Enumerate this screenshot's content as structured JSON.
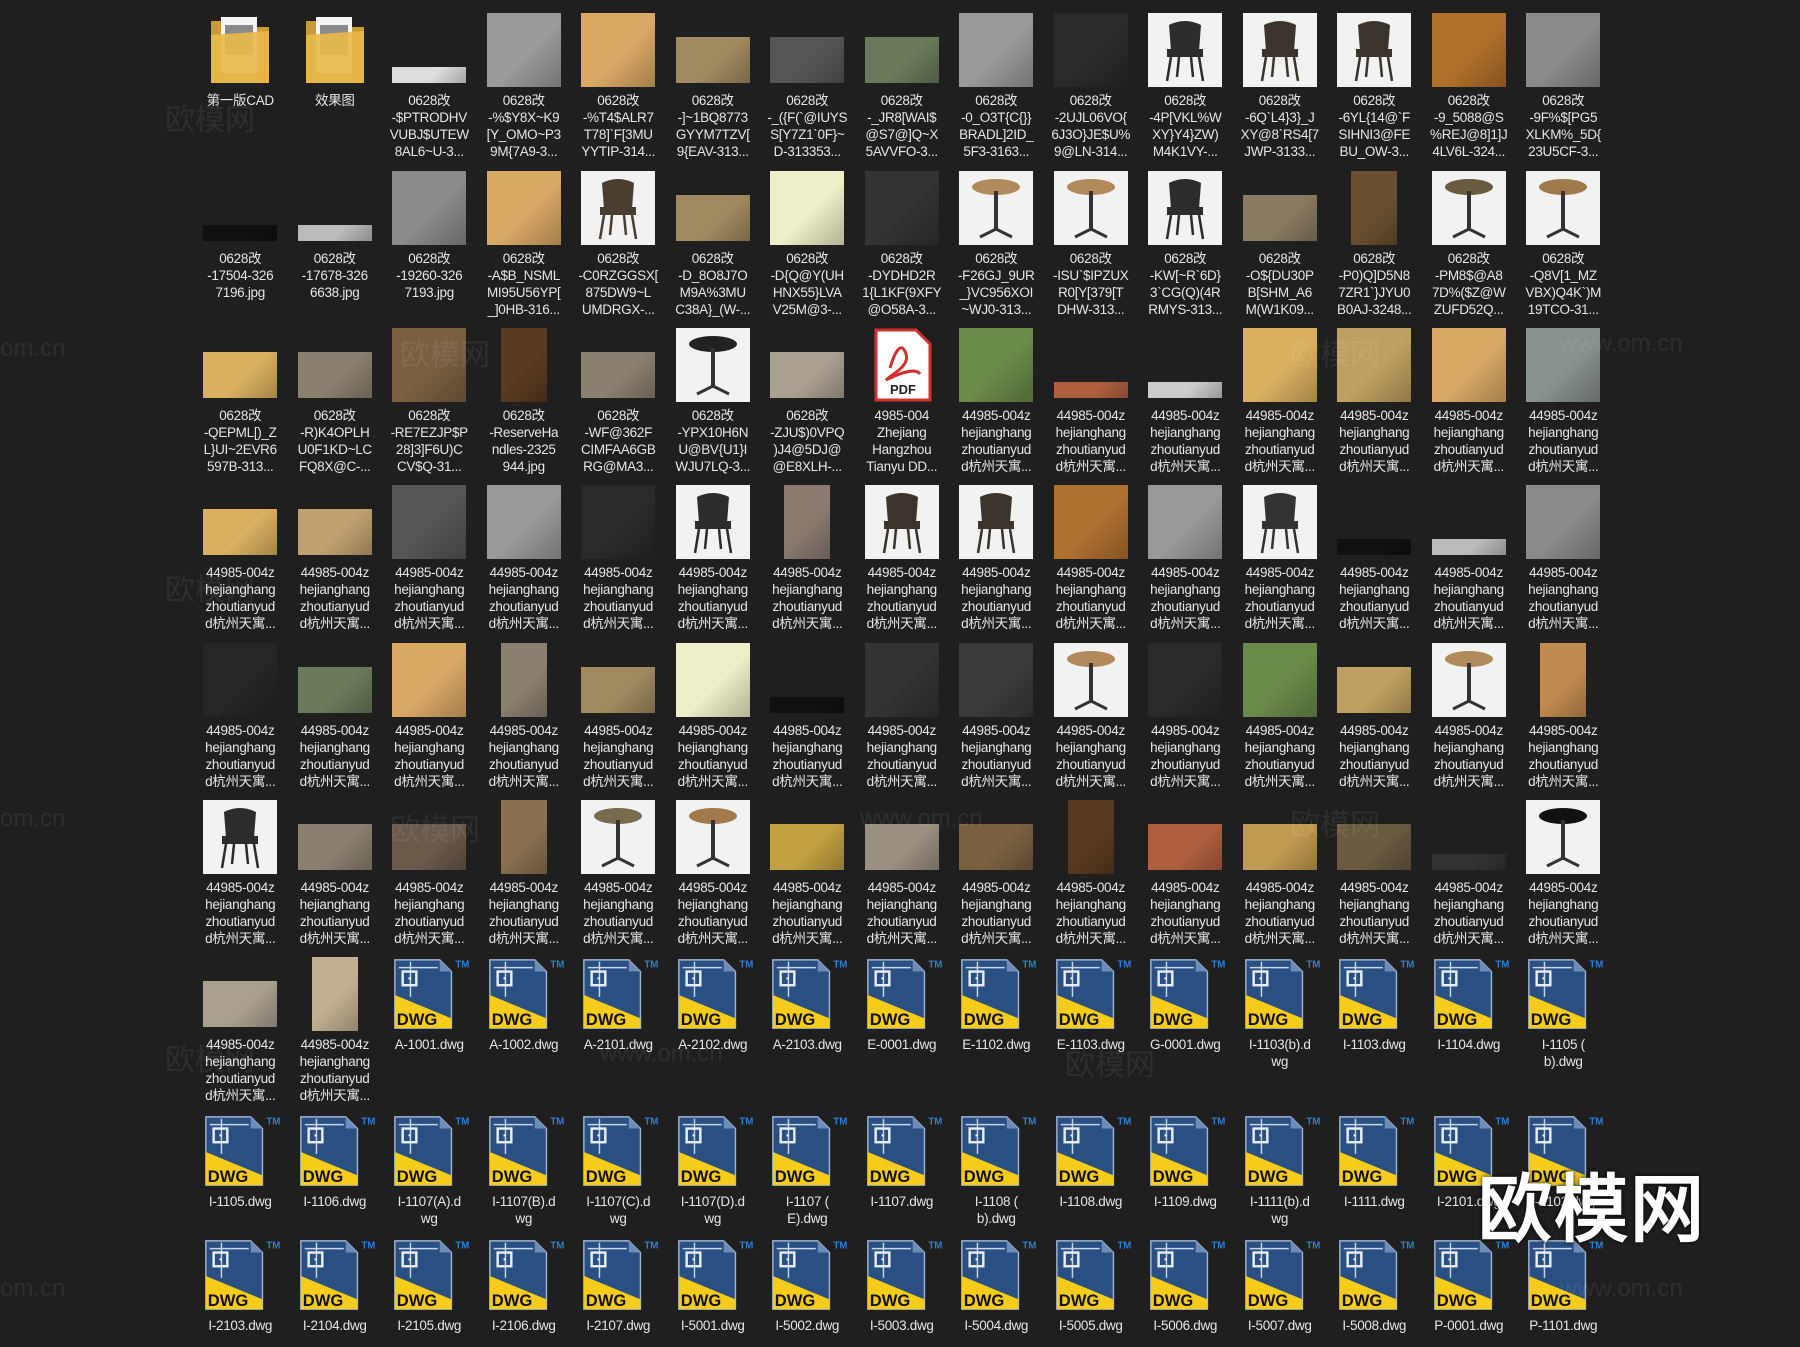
{
  "rows": [
    [
      {
        "label": "第一版CAD",
        "kind": "folder",
        "color": "#e8b84a"
      },
      {
        "label": "效果图",
        "kind": "folder",
        "color": "#e8b84a"
      },
      {
        "label": "0628改\n-$PTRODHV\nVUBJ$UTEW\n8AL6~U-3...",
        "kind": "strip",
        "color": "#dddddd"
      },
      {
        "label": "0628改\n-%$Y8X~K9\n[Y_OMO~P3\n9M{7A9-3...",
        "kind": "sq",
        "color": "#9a9a9a"
      },
      {
        "label": "0628改\n-%T4$ALR7\nT78]`F[3MU\nYYTIP-314...",
        "kind": "sq",
        "color": "#d9a865"
      },
      {
        "label": "0628改\n-]~1BQ8773\nGYYM7TZV[\n9{EAV-313...",
        "kind": "wide",
        "color": "#a08a60"
      },
      {
        "label": "0628改\n-_({F(`@IUYS\nS[Y7Z1`0F}~\nD-313353...",
        "kind": "wide",
        "color": "#555555"
      },
      {
        "label": "0628改\n-_JR8[WAI$\n@S7@]Q~X\n5AVVFO-3...",
        "kind": "wide",
        "color": "#6a7a5a"
      },
      {
        "label": "0628改\n-0_O3T{C{}}\nBRADL]2ID_\n5F3-3163...",
        "kind": "sq",
        "color": "#999999"
      },
      {
        "label": "0628改\n-2UJL06VO{\n6J3O}JE$U%\n9@LN-314...",
        "kind": "sq",
        "color": "#2a2a2a"
      },
      {
        "label": "0628改\n-4P[VKL%W\nXY}Y4}ZW)\nM4K1VY-...",
        "kind": "chair",
        "color": "#2c2c2c"
      },
      {
        "label": "0628改\n-6Q`L4}3}_J\nXY@8`RS4[7\nJWP-3133...",
        "kind": "chair",
        "color": "#3a342c"
      },
      {
        "label": "0628改\n-6YL{14@`F\nSIHNI3@FE\nBU_OW-3...",
        "kind": "chair",
        "color": "#3a342c"
      },
      {
        "label": "0628改\n-9_5088@S\n%REJ@8]1]J\n4LV6L-324...",
        "kind": "sq",
        "color": "#b0702a"
      },
      {
        "label": "0628改\n-9F%$[PG5\nXLKM%_5D{\n23U5CF-3...",
        "kind": "sq",
        "color": "#8a8a8a"
      }
    ],
    [
      {
        "label": "0628改\n-17504-326\n7196.jpg",
        "kind": "strip",
        "color": "#111111"
      },
      {
        "label": "0628改\n-17678-326\n6638.jpg",
        "kind": "strip",
        "color": "#bbbbbb"
      },
      {
        "label": "0628改\n-19260-326\n7193.jpg",
        "kind": "sq",
        "color": "#8a8a8a"
      },
      {
        "label": "0628改\n-A$B_NSML\nMI95U56YP[\n_]0HB-316...",
        "kind": "sq",
        "color": "#d9a865"
      },
      {
        "label": "0628改\n-C0RZGGSX[\n875DW9~L\nUMDRGX-...",
        "kind": "chair",
        "color": "#4a3e30"
      },
      {
        "label": "0628改\n-D_8O8J7O\nM9A%3MU\nC38A}_(W-...",
        "kind": "wide",
        "color": "#a08a60"
      },
      {
        "label": "0628改\n-D{Q@Y(UH\nHNX55}LVA\nV25M@3-...",
        "kind": "sq",
        "color": "#eeeec8"
      },
      {
        "label": "0628改\n-DYDHD2R\n1{L1KF(9XFY\n@O58A-3...",
        "kind": "sq",
        "color": "#333333"
      },
      {
        "label": "0628改\n-F26GJ_9UR\n_}VC956XOI\n~WJ0-313...",
        "kind": "table",
        "color": "#b08a5a"
      },
      {
        "label": "0628改\n-ISU`$IPZUX\nR0[Y[379[T\nDHW-313...",
        "kind": "table",
        "color": "#b08a5a"
      },
      {
        "label": "0628改\n-KW[~R`6D}\n3`CG(Q)(4R\nRMYS-313...",
        "kind": "chair",
        "color": "#2c2c2c"
      },
      {
        "label": "0628改\n-O${DU30P\nB[SHM_A6\nM(W1K09...",
        "kind": "wide",
        "color": "#8a7a60"
      },
      {
        "label": "0628改\n-P0)Q]D5N8\n7ZR1`}JYU0\nB0AJ-3248...",
        "kind": "tall",
        "color": "#6a5030"
      },
      {
        "label": "0628改\n-PM8$@A8\n7D%($Z@W\nZUFD52Q...",
        "kind": "table",
        "color": "#6a5a40"
      },
      {
        "label": "0628改\n-Q8V[1_MZ\nVBX)Q4K`)M\n19TCO-31...",
        "kind": "table",
        "color": "#a07a4a"
      }
    ],
    [
      {
        "label": "0628改\n-QEPML[)_Z\nL}UI~2EVR6\n597B-313...",
        "kind": "wide",
        "color": "#d9b060"
      },
      {
        "label": "0628改\n-R)K4OPLH\nU0F1KD~LC\nFQ8X@C-...",
        "kind": "wide",
        "color": "#8a8070"
      },
      {
        "label": "0628改\n-RE7EZJP$P\n28]3]F6U)C\nCV$Q-31...",
        "kind": "sq",
        "color": "#7a6040"
      },
      {
        "label": "0628改\n-ReserveHa\nndles-2325\n944.jpg",
        "kind": "tall",
        "color": "#5a3a20"
      },
      {
        "label": "0628改\n-WF@362F\nCIMFAA6GB\nRG@MA3...",
        "kind": "wide",
        "color": "#8a8070"
      },
      {
        "label": "0628改\n-YPX10H6N\nU@BV{U1}I\nWJU7LQ-3...",
        "kind": "table",
        "color": "#222222"
      },
      {
        "label": "0628改\n-ZJU$)0VPQ\n)J4@5DJ@\n@E8XLH-...",
        "kind": "wide",
        "color": "#aaa090"
      },
      {
        "label": "4985-004\nZhejiang\nHangzhou\nTianyu DD...",
        "kind": "pdf",
        "color": "#d0312d",
        "badge": "PDF"
      },
      {
        "label": "44985-004z\nhejianghang\nzhoutianyud\nd杭州天寓...",
        "kind": "sq",
        "color": "#6a8a4a"
      },
      {
        "label": "44985-004z\nhejianghang\nzhoutianyud\nd杭州天寓...",
        "kind": "strip",
        "color": "#b06040"
      },
      {
        "label": "44985-004z\nhejianghang\nzhoutianyud\nd杭州天寓...",
        "kind": "strip",
        "color": "#cccccc"
      },
      {
        "label": "44985-004z\nhejianghang\nzhoutianyud\nd杭州天寓...",
        "kind": "sq",
        "color": "#d9b060"
      },
      {
        "label": "44985-004z\nhejianghang\nzhoutianyud\nd杭州天寓...",
        "kind": "sq",
        "color": "#c0a060"
      },
      {
        "label": "44985-004z\nhejianghang\nzhoutianyud\nd杭州天寓...",
        "kind": "sq",
        "color": "#d9a865"
      },
      {
        "label": "44985-004z\nhejianghang\nzhoutianyud\nd杭州天寓...",
        "kind": "sq",
        "color": "#889090"
      }
    ],
    [
      {
        "label": "44985-004z\nhejianghang\nzhoutianyud\nd杭州天寓...",
        "kind": "wide",
        "color": "#d9b060"
      },
      {
        "label": "44985-004z\nhejianghang\nzhoutianyud\nd杭州天寓...",
        "kind": "wide",
        "color": "#c0a070"
      },
      {
        "label": "44985-004z\nhejianghang\nzhoutianyud\nd杭州天寓...",
        "kind": "sq",
        "color": "#555555"
      },
      {
        "label": "44985-004z\nhejianghang\nzhoutianyud\nd杭州天寓...",
        "kind": "sq",
        "color": "#999999"
      },
      {
        "label": "44985-004z\nhejianghang\nzhoutianyud\nd杭州天寓...",
        "kind": "sq",
        "color": "#2a2a2a"
      },
      {
        "label": "44985-004z\nhejianghang\nzhoutianyud\nd杭州天寓...",
        "kind": "chair",
        "color": "#2c2c2c"
      },
      {
        "label": "44985-004z\nhejianghang\nzhoutianyud\nd杭州天寓...",
        "kind": "tall",
        "color": "#8a7a70"
      },
      {
        "label": "44985-004z\nhejianghang\nzhoutianyud\nd杭州天寓...",
        "kind": "chair",
        "color": "#3a342c"
      },
      {
        "label": "44985-004z\nhejianghang\nzhoutianyud\nd杭州天寓...",
        "kind": "chair",
        "color": "#3a342c"
      },
      {
        "label": "44985-004z\nhejianghang\nzhoutianyud\nd杭州天寓...",
        "kind": "sq",
        "color": "#b07030"
      },
      {
        "label": "44985-004z\nhejianghang\nzhoutianyud\nd杭州天寓...",
        "kind": "sq",
        "color": "#999999"
      },
      {
        "label": "44985-004z\nhejianghang\nzhoutianyud\nd杭州天寓...",
        "kind": "chair",
        "color": "#333333"
      },
      {
        "label": "44985-004z\nhejianghang\nzhoutianyud\nd杭州天寓...",
        "kind": "strip",
        "color": "#111111"
      },
      {
        "label": "44985-004z\nhejianghang\nzhoutianyud\nd杭州天寓...",
        "kind": "strip",
        "color": "#bbbbbb"
      },
      {
        "label": "44985-004z\nhejianghang\nzhoutianyud\nd杭州天寓...",
        "kind": "sq",
        "color": "#8a8a8a"
      }
    ],
    [
      {
        "label": "44985-004z\nhejianghang\nzhoutianyud\nd杭州天寓...",
        "kind": "sq",
        "color": "#262626"
      },
      {
        "label": "44985-004z\nhejianghang\nzhoutianyud\nd杭州天寓...",
        "kind": "wide",
        "color": "#6a7a5a"
      },
      {
        "label": "44985-004z\nhejianghang\nzhoutianyud\nd杭州天寓...",
        "kind": "sq",
        "color": "#d9a865"
      },
      {
        "label": "44985-004z\nhejianghang\nzhoutianyud\nd杭州天寓...",
        "kind": "tall",
        "color": "#8a8070"
      },
      {
        "label": "44985-004z\nhejianghang\nzhoutianyud\nd杭州天寓...",
        "kind": "wide",
        "color": "#a08a60"
      },
      {
        "label": "44985-004z\nhejianghang\nzhoutianyud\nd杭州天寓...",
        "kind": "sq",
        "color": "#eeeec8"
      },
      {
        "label": "44985-004z\nhejianghang\nzhoutianyud\nd杭州天寓...",
        "kind": "strip",
        "color": "#111111"
      },
      {
        "label": "44985-004z\nhejianghang\nzhoutianyud\nd杭州天寓...",
        "kind": "sq",
        "color": "#333333"
      },
      {
        "label": "44985-004z\nhejianghang\nzhoutianyud\nd杭州天寓...",
        "kind": "sq",
        "color": "#3a3a3a"
      },
      {
        "label": "44985-004z\nhejianghang\nzhoutianyud\nd杭州天寓...",
        "kind": "table",
        "color": "#b08a5a"
      },
      {
        "label": "44985-004z\nhejianghang\nzhoutianyud\nd杭州天寓...",
        "kind": "sq",
        "color": "#2a2a2a"
      },
      {
        "label": "44985-004z\nhejianghang\nzhoutianyud\nd杭州天寓...",
        "kind": "sq",
        "color": "#6a8a4a"
      },
      {
        "label": "44985-004z\nhejianghang\nzhoutianyud\nd杭州天寓...",
        "kind": "wide",
        "color": "#c0a060"
      },
      {
        "label": "44985-004z\nhejianghang\nzhoutianyud\nd杭州天寓...",
        "kind": "table",
        "color": "#b08a5a"
      },
      {
        "label": "44985-004z\nhejianghang\nzhoutianyud\nd杭州天寓...",
        "kind": "tall",
        "color": "#c08a50"
      }
    ],
    [
      {
        "label": "44985-004z\nhejianghang\nzhoutianyud\nd杭州天寓...",
        "kind": "chair",
        "color": "#2c2c2c"
      },
      {
        "label": "44985-004z\nhejianghang\nzhoutianyud\nd杭州天寓...",
        "kind": "wide",
        "color": "#8a8070"
      },
      {
        "label": "44985-004z\nhejianghang\nzhoutianyud\nd杭州天寓...",
        "kind": "wide",
        "color": "#6a5a4a"
      },
      {
        "label": "44985-004z\nhejianghang\nzhoutianyud\nd杭州天寓...",
        "kind": "tall",
        "color": "#8a7050"
      },
      {
        "label": "44985-004z\nhejianghang\nzhoutianyud\nd杭州天寓...",
        "kind": "table",
        "color": "#7a6a50"
      },
      {
        "label": "44985-004z\nhejianghang\nzhoutianyud\nd杭州天寓...",
        "kind": "table",
        "color": "#a07a4a"
      },
      {
        "label": "44985-004z\nhejianghang\nzhoutianyud\nd杭州天寓...",
        "kind": "wide",
        "color": "#c0a040"
      },
      {
        "label": "44985-004z\nhejianghang\nzhoutianyud\nd杭州天寓...",
        "kind": "wide",
        "color": "#9a9080"
      },
      {
        "label": "44985-004z\nhejianghang\nzhoutianyud\nd杭州天寓...",
        "kind": "wide",
        "color": "#7a6040"
      },
      {
        "label": "44985-004z\nhejianghang\nzhoutianyud\nd杭州天寓...",
        "kind": "tall",
        "color": "#5a3a20"
      },
      {
        "label": "44985-004z\nhejianghang\nzhoutianyud\nd杭州天寓...",
        "kind": "wide",
        "color": "#b06040"
      },
      {
        "label": "44985-004z\nhejianghang\nzhoutianyud\nd杭州天寓...",
        "kind": "wide",
        "color": "#c09a50"
      },
      {
        "label": "44985-004z\nhejianghang\nzhoutianyud\nd杭州天寓...",
        "kind": "wide",
        "color": "#6a5a40"
      },
      {
        "label": "44985-004z\nhejianghang\nzhoutianyud\nd杭州天寓...",
        "kind": "strip",
        "color": "#333333"
      },
      {
        "label": "44985-004z\nhejianghang\nzhoutianyud\nd杭州天寓...",
        "kind": "table",
        "color": "#111111"
      }
    ],
    [
      {
        "label": "44985-004z\nhejianghang\nzhoutianyud\nd杭州天寓...",
        "kind": "wide",
        "color": "#aaa090"
      },
      {
        "label": "44985-004z\nhejianghang\nzhoutianyud\nd杭州天寓...",
        "kind": "tall",
        "color": "#c0b090"
      },
      {
        "label": "A-1001.dwg",
        "kind": "dwg"
      },
      {
        "label": "A-1002.dwg",
        "kind": "dwg"
      },
      {
        "label": "A-2101.dwg",
        "kind": "dwg"
      },
      {
        "label": "A-2102.dwg",
        "kind": "dwg"
      },
      {
        "label": "A-2103.dwg",
        "kind": "dwg"
      },
      {
        "label": "E-0001.dwg",
        "kind": "dwg"
      },
      {
        "label": "E-1102.dwg",
        "kind": "dwg"
      },
      {
        "label": "E-1103.dwg",
        "kind": "dwg"
      },
      {
        "label": "G-0001.dwg",
        "kind": "dwg"
      },
      {
        "label": "I-1103(b).d\nwg",
        "kind": "dwg"
      },
      {
        "label": "I-1103.dwg",
        "kind": "dwg"
      },
      {
        "label": "I-1104.dwg",
        "kind": "dwg"
      },
      {
        "label": "I-1105 (\nb).dwg",
        "kind": "dwg"
      }
    ],
    [
      {
        "label": "I-1105.dwg",
        "kind": "dwg"
      },
      {
        "label": "I-1106.dwg",
        "kind": "dwg"
      },
      {
        "label": "I-1107(A).d\nwg",
        "kind": "dwg"
      },
      {
        "label": "I-1107(B).d\nwg",
        "kind": "dwg"
      },
      {
        "label": "I-1107(C).d\nwg",
        "kind": "dwg"
      },
      {
        "label": "I-1107(D).d\nwg",
        "kind": "dwg"
      },
      {
        "label": "I-1107 (\nE).dwg",
        "kind": "dwg"
      },
      {
        "label": "I-1107.dwg",
        "kind": "dwg"
      },
      {
        "label": "I-1108 (\nb).dwg",
        "kind": "dwg"
      },
      {
        "label": "I-1108.dwg",
        "kind": "dwg"
      },
      {
        "label": "I-1109.dwg",
        "kind": "dwg"
      },
      {
        "label": "I-1111(b).d\nwg",
        "kind": "dwg"
      },
      {
        "label": "I-1111.dwg",
        "kind": "dwg"
      },
      {
        "label": "I-2101.dwg",
        "kind": "dwg"
      },
      {
        "label": "I-2102.dwg",
        "kind": "dwg"
      }
    ],
    [
      {
        "label": "I-2103.dwg",
        "kind": "dwg"
      },
      {
        "label": "I-2104.dwg",
        "kind": "dwg"
      },
      {
        "label": "I-2105.dwg",
        "kind": "dwg"
      },
      {
        "label": "I-2106.dwg",
        "kind": "dwg"
      },
      {
        "label": "I-2107.dwg",
        "kind": "dwg"
      },
      {
        "label": "I-5001.dwg",
        "kind": "dwg"
      },
      {
        "label": "I-5002.dwg",
        "kind": "dwg"
      },
      {
        "label": "I-5003.dwg",
        "kind": "dwg"
      },
      {
        "label": "I-5004.dwg",
        "kind": "dwg"
      },
      {
        "label": "I-5005.dwg",
        "kind": "dwg"
      },
      {
        "label": "I-5006.dwg",
        "kind": "dwg"
      },
      {
        "label": "I-5007.dwg",
        "kind": "dwg"
      },
      {
        "label": "I-5008.dwg",
        "kind": "dwg"
      },
      {
        "label": "P-0001.dwg",
        "kind": "dwg"
      },
      {
        "label": "P-1101.dwg",
        "kind": "dwg"
      }
    ]
  ],
  "dwg_icon": {
    "text": "DWG",
    "tm": "TM",
    "blue": "#2a4f82",
    "yellow": "#f5cc1a",
    "tm_color": "#2f7fd0"
  },
  "watermark": {
    "brand": "欧模网",
    "site": "www.om.cn",
    "site_short": "om.cn"
  },
  "colors": {
    "background": "#1f1f1f",
    "label": "#e6e6e6"
  }
}
